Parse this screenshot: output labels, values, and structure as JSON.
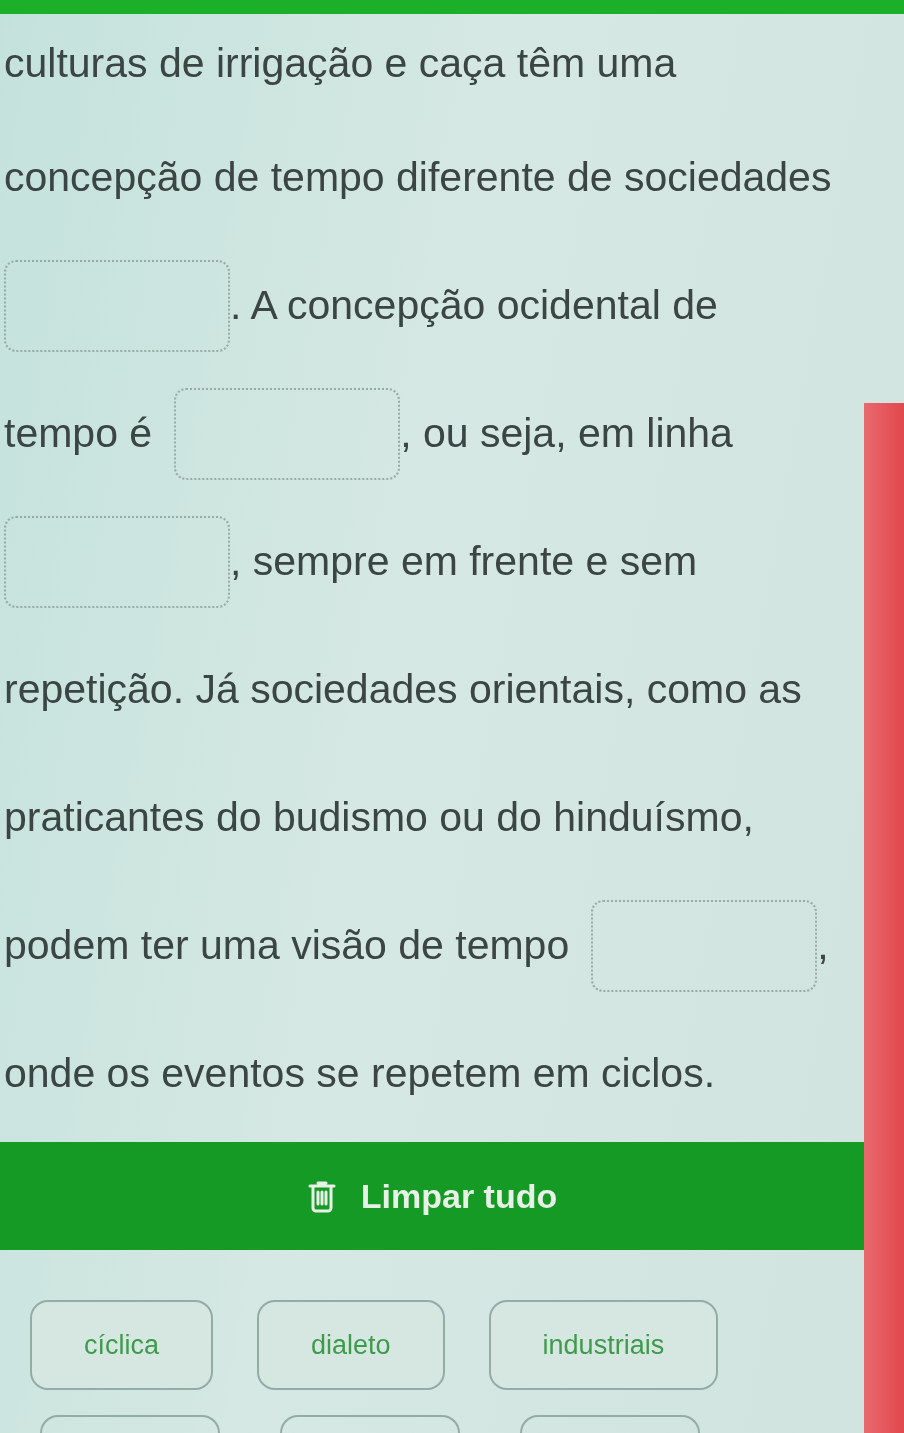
{
  "passage": {
    "lines": [
      [
        {
          "kind": "text",
          "text": "culturas de irrigação e caça têm uma"
        }
      ],
      [
        {
          "kind": "text",
          "text": "concepção de tempo diferente de sociedades"
        }
      ],
      [
        {
          "kind": "blank"
        },
        {
          "kind": "text",
          "text": ". A concepção ocidental de"
        }
      ],
      [
        {
          "kind": "text",
          "text": "tempo é"
        },
        {
          "kind": "blank"
        },
        {
          "kind": "text",
          "text": ", ou seja, em linha"
        }
      ],
      [
        {
          "kind": "blank"
        },
        {
          "kind": "text",
          "text": ", sempre em frente e sem"
        }
      ],
      [
        {
          "kind": "text",
          "text": "repetição. Já sociedades orientais, como as"
        }
      ],
      [
        {
          "kind": "text",
          "text": "praticantes do budismo ou do hinduísmo,"
        }
      ],
      [
        {
          "kind": "text",
          "text": "podem ter uma visão de tempo"
        },
        {
          "kind": "blank"
        },
        {
          "kind": "text",
          "text": ","
        }
      ],
      [
        {
          "kind": "text",
          "text": "onde os eventos se repetem em ciclos."
        }
      ]
    ]
  },
  "clear_button": {
    "label": "Limpar tudo"
  },
  "word_bank": [
    {
      "kind": "word",
      "label": "cíclica"
    },
    {
      "kind": "word",
      "label": "dialeto"
    },
    {
      "kind": "word",
      "label": "industriais"
    },
    {
      "kind": "cut_off"
    },
    {
      "kind": "cut_off"
    },
    {
      "kind": "cut_off"
    }
  ]
}
